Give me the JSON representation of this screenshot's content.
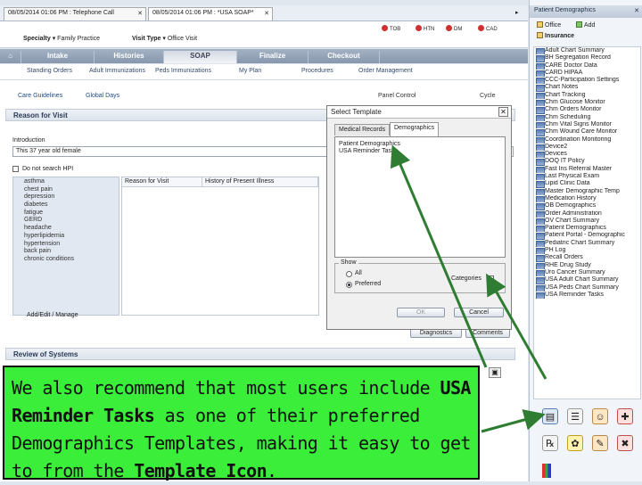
{
  "doc_tabs": [
    {
      "label": "08/05/2014 01:06 PM : Telephone Call"
    },
    {
      "label": "08/05/2014 01:06 PM : *USA SOAP*"
    }
  ],
  "patient_bar": {
    "specialty_label": "Specialty",
    "specialty_value": "Family Practice",
    "visit_type_label": "Visit Type",
    "visit_type_value": "Office Visit",
    "flags": [
      {
        "label": "TOB",
        "color": "#d03030"
      },
      {
        "label": "HTN",
        "color": "#d03030"
      },
      {
        "label": "DM",
        "color": "#d03030"
      },
      {
        "label": "CAD",
        "color": "#d03030"
      }
    ]
  },
  "main_nav": [
    "Intake",
    "Histories",
    "SOAP",
    "Finalize",
    "Checkout"
  ],
  "sub_nav": [
    "Standing Orders",
    "Adult Immunizations",
    "Peds Immunizations",
    "My Plan",
    "Procedures",
    "Order Management"
  ],
  "content": {
    "links": [
      "Care Guidelines",
      "Global Days"
    ],
    "panel_controls": "Panel Control",
    "cycle_label": "Cycle",
    "reason_for_visit_header": "Reason for Visit",
    "introduction_label": "Introduction",
    "introduction_value": "This 37 year old female",
    "do_not_search_label": "Do not search HPI",
    "complaints": [
      "asthma",
      "chest pain",
      "depression",
      "diabetes",
      "fatigue",
      "GERD",
      "headache",
      "hyperlipidemia",
      "hypertension",
      "back pain",
      "chronic conditions"
    ],
    "grid_headers": [
      "Reason for Visit",
      "History of Present Illness"
    ],
    "add_edit_label": "Add/Edit / Manage",
    "diagnostics_button": "Diagnostics",
    "comments_button": "Comments",
    "review_of_systems_header": "Review of Systems"
  },
  "dialog": {
    "title": "Select Template",
    "tabs": [
      "Medical Records",
      "Demographics"
    ],
    "active_tab": "Demographics",
    "templates": [
      "Patient Demographics",
      "USA Reminder Tasks"
    ],
    "show_label": "Show",
    "options": [
      "All",
      "Preferred"
    ],
    "selected_option": "Preferred",
    "categories_label": "Categories",
    "ok_button": "OK",
    "cancel_button": "Cancel"
  },
  "sidebar": {
    "header": "Patient Demographics",
    "tools": [
      "Office",
      "Add",
      "Insurance"
    ],
    "items": [
      "Adult Chart Summary",
      "BH Segregation Record",
      "CARE Doctor Data",
      "CARD HIPAA",
      "CCC-Participation Settings",
      "Chart Notes",
      "Chart Tracking",
      "Chm Glucose Monitor",
      "Chm Orders Monitor",
      "Chm Scheduling",
      "Chm Vital Signs Monitor",
      "Chm Wound Care Monitor",
      "Coordination Monitoring",
      "Device2",
      "Devices",
      "DOQ IT Policy",
      "Fast Ins Referral Master",
      "Last Physical Exam",
      "Lipid Clinic Data",
      "Master Demographic Temp",
      "Medication History",
      "OB Demographics",
      "Order Administration",
      "OV Chart Summary",
      "Patient Demographics",
      "Patient Portal - Demographic",
      "Pediatric Chart Summary",
      "PH Log",
      "Recall Orders",
      "RHE Drug Study",
      "Uro Cancer Summary",
      "USA Adult Chart Summary",
      "USA Peds Chart Summary",
      "USA Reminder Tasks"
    ]
  },
  "callout": {
    "part1": "We also recommend that most users include ",
    "bold1": "USA Reminder Tasks",
    "part2": " as one of their preferred Demographics Templates, making it easy to get to from the ",
    "bold2": "Template Icon",
    "part3": "."
  },
  "colors": {
    "callout_bg": "#3aee3a",
    "arrow": "#2e7d32"
  }
}
